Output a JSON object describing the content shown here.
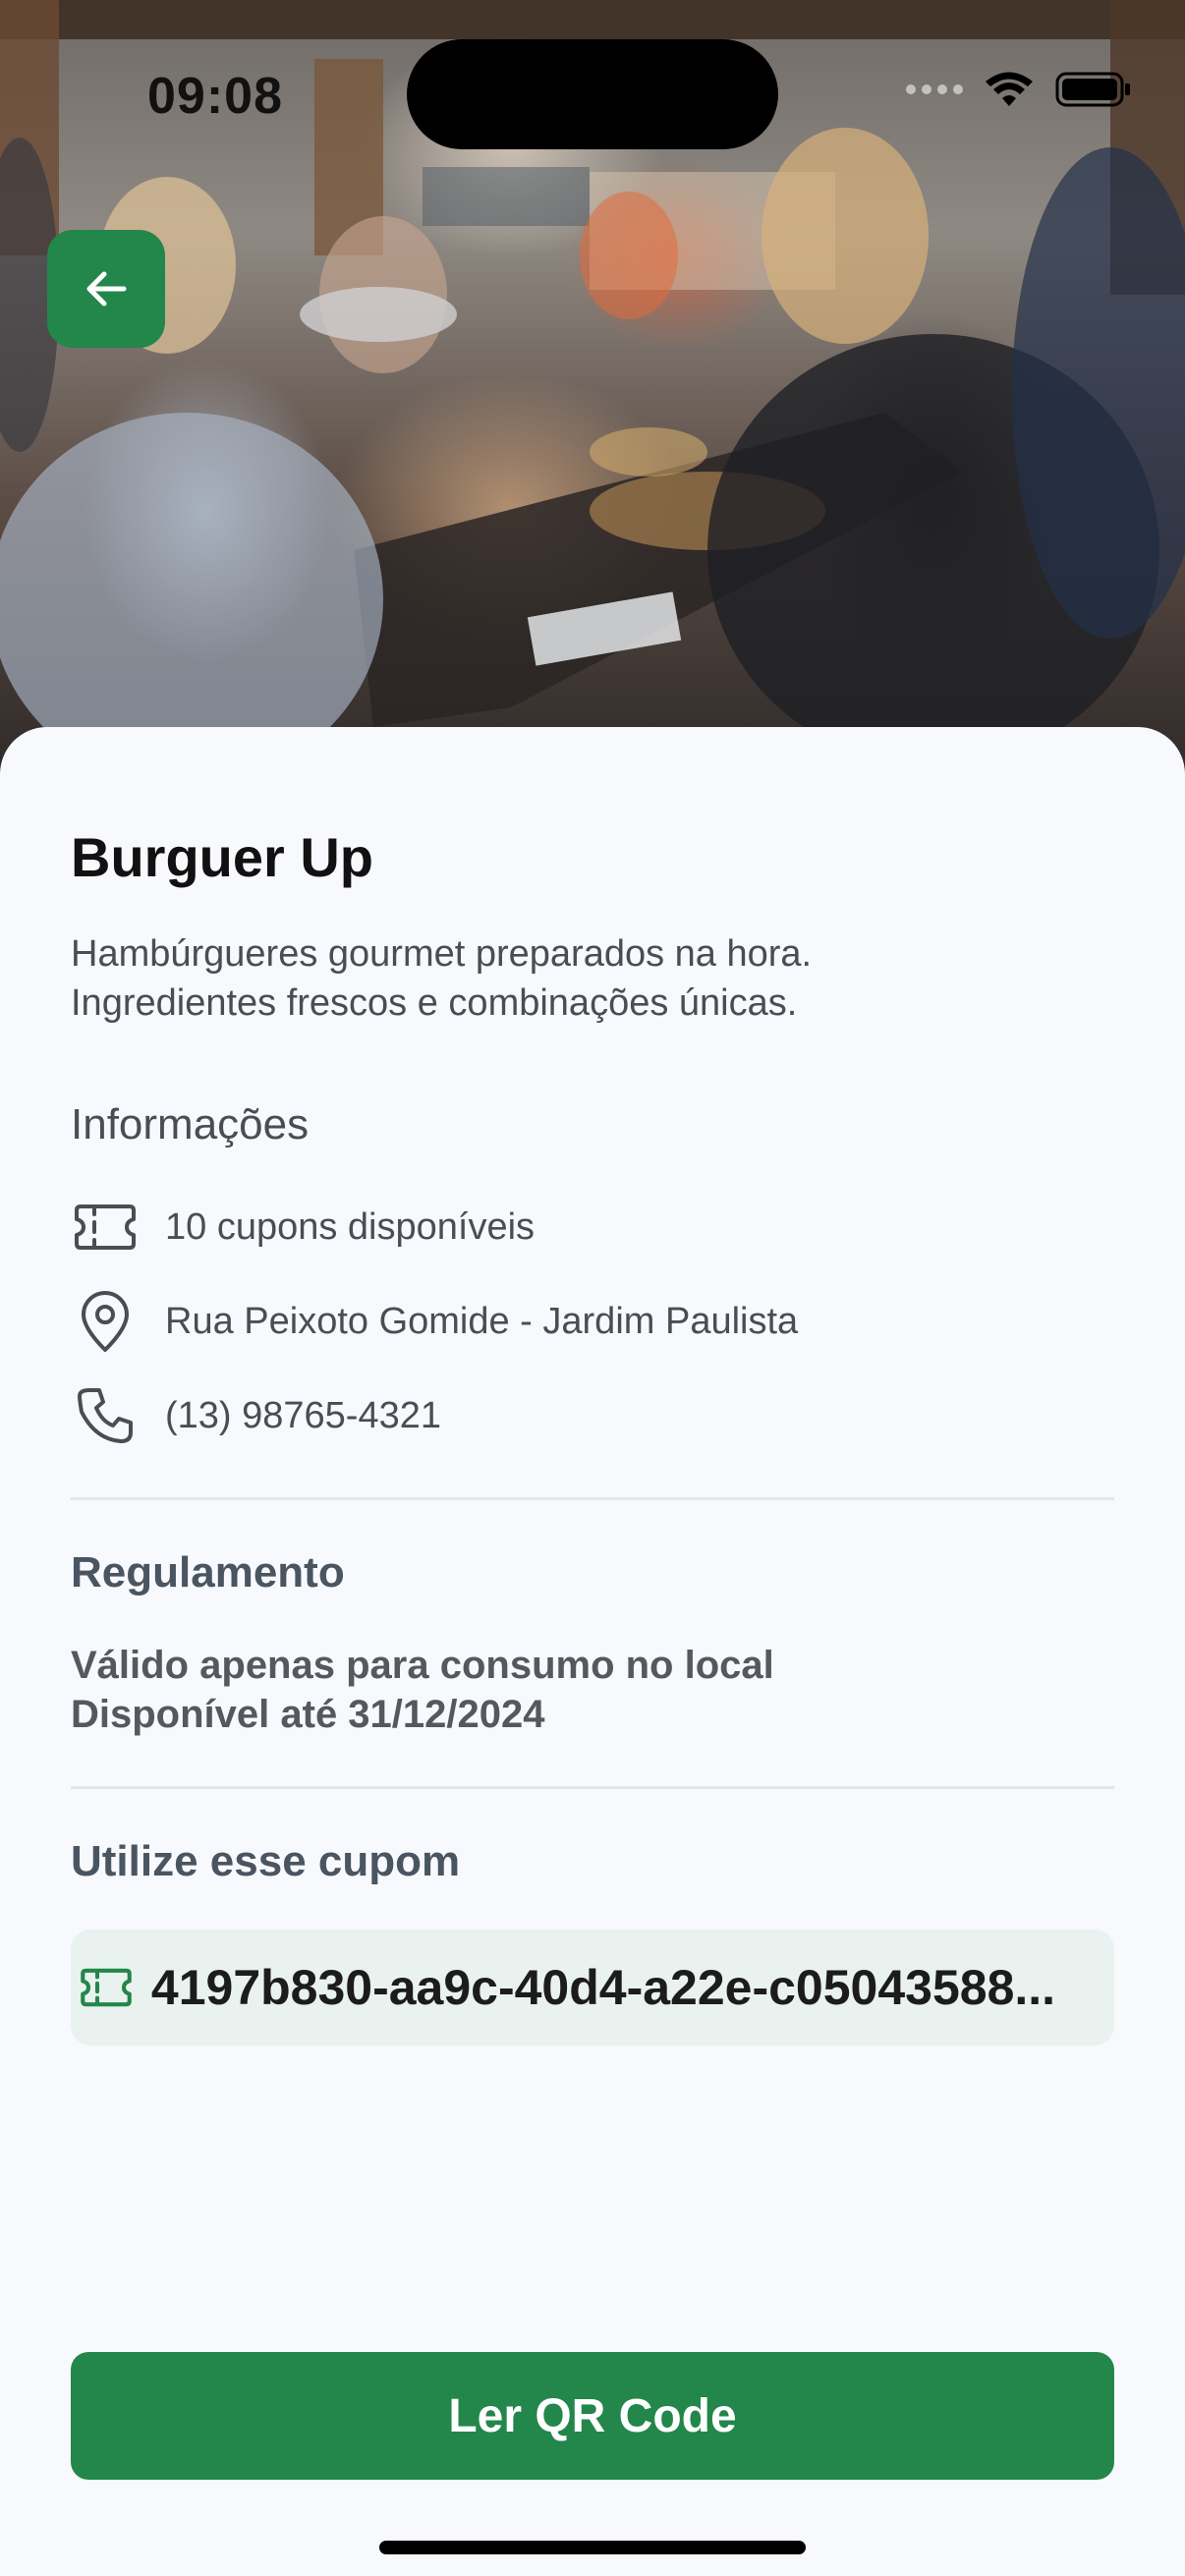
{
  "status_bar": {
    "time": "09:08"
  },
  "header": {
    "back_icon": "arrow-left-icon",
    "accent_color": "#23864b"
  },
  "store": {
    "name": "Burguer Up",
    "description_lines": [
      "Hambúrgueres gourmet preparados na hora.",
      "Ingredientes frescos e combinações únicas."
    ]
  },
  "info": {
    "title": "Informações",
    "items": [
      {
        "icon": "ticket-icon",
        "text": "10 cupons disponíveis"
      },
      {
        "icon": "map-pin-icon",
        "text": "Rua Peixoto Gomide - Jardim Paulista"
      },
      {
        "icon": "phone-icon",
        "text": "(13) 98765-4321"
      }
    ]
  },
  "rules": {
    "title": "Regulamento",
    "lines": [
      "Válido apenas para consumo no local",
      "Disponível até 31/12/2024"
    ]
  },
  "coupon": {
    "title": "Utilize esse cupom",
    "icon": "ticket-icon",
    "code": "4197b830-aa9c-40d4-a22e-c05043588..."
  },
  "actions": {
    "scan_qr_label": "Ler QR Code"
  }
}
